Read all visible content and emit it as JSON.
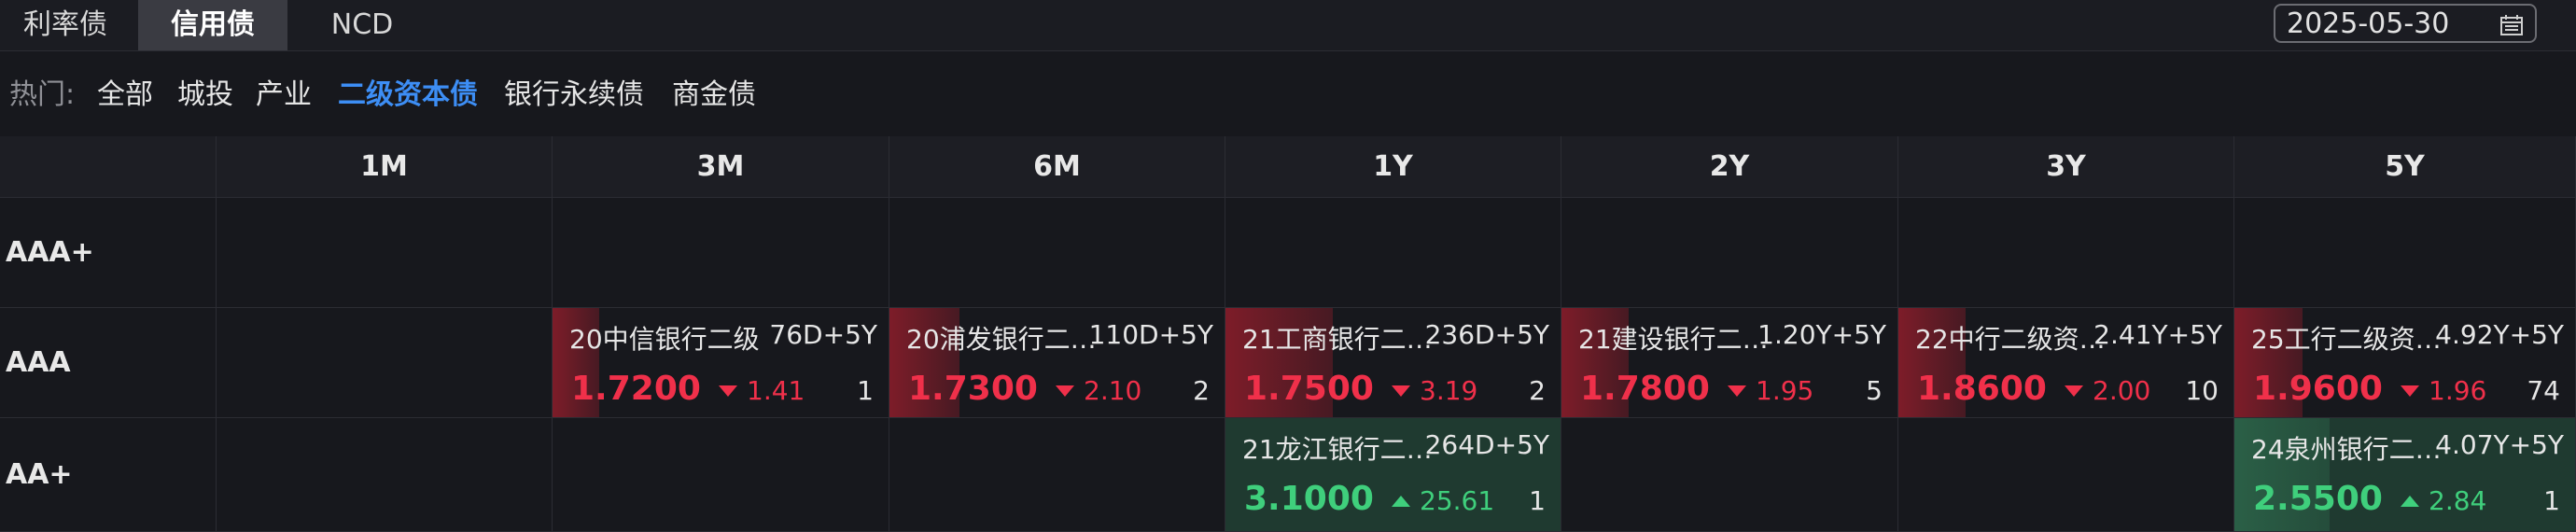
{
  "tabs": [
    {
      "label": "利率债",
      "active": false
    },
    {
      "label": "信用债",
      "active": true
    },
    {
      "label": "NCD",
      "active": false
    }
  ],
  "date": {
    "value": "2025-05-30",
    "icon": "calendar-icon"
  },
  "hot": {
    "label": "热门:",
    "filters": [
      {
        "label": "全部",
        "active": false
      },
      {
        "label": "城投",
        "active": false
      },
      {
        "label": "产业",
        "active": false
      },
      {
        "label": "二级资本债",
        "active": true
      },
      {
        "label": "银行永续债",
        "active": false
      },
      {
        "label": "商金债",
        "active": false
      }
    ]
  },
  "colors": {
    "up_red": "#f0304a",
    "down_green": "#3fcf7c",
    "accent_blue": "#3d8ef5"
  },
  "table": {
    "columns": [
      "1M",
      "3M",
      "6M",
      "1Y",
      "2Y",
      "3Y",
      "5Y"
    ],
    "rows": [
      {
        "label": "AAA+",
        "cells": [
          null,
          null,
          null,
          null,
          null,
          null,
          null
        ]
      },
      {
        "label": "AAA",
        "cells": [
          null,
          {
            "name": "20中信银行二级",
            "term": "76D+5Y",
            "yield": "1.7200",
            "change": "1.41",
            "direction": "down",
            "count": "1",
            "bar": 0.14
          },
          {
            "name": "20浦发银行二…",
            "term": "110D+5Y",
            "yield": "1.7300",
            "change": "2.10",
            "direction": "down",
            "count": "2",
            "bar": 0.21
          },
          {
            "name": "21工商银行二…",
            "term": "236D+5Y",
            "yield": "1.7500",
            "change": "3.19",
            "direction": "down",
            "count": "2",
            "bar": 0.32
          },
          {
            "name": "21建设银行二…",
            "term": "1.20Y+5Y",
            "yield": "1.7800",
            "change": "1.95",
            "direction": "down",
            "count": "5",
            "bar": 0.2
          },
          {
            "name": "22中行二级资…",
            "term": "2.41Y+5Y",
            "yield": "1.8600",
            "change": "2.00",
            "direction": "down",
            "count": "10",
            "bar": 0.2
          },
          {
            "name": "25工行二级资…",
            "term": "4.92Y+5Y",
            "yield": "1.9600",
            "change": "1.96",
            "direction": "down",
            "count": "74",
            "bar": 0.2
          }
        ]
      },
      {
        "label": "AA+",
        "cells": [
          null,
          null,
          null,
          {
            "name": "21龙江银行二…",
            "term": "264D+5Y",
            "yield": "3.1000",
            "change": "25.61",
            "direction": "up",
            "count": "1",
            "bar": 0
          },
          null,
          null,
          {
            "name": "24泉州银行二…",
            "term": "4.07Y+5Y",
            "yield": "2.5500",
            "change": "2.84",
            "direction": "up",
            "count": "1",
            "bar": 0.28
          }
        ]
      }
    ]
  }
}
